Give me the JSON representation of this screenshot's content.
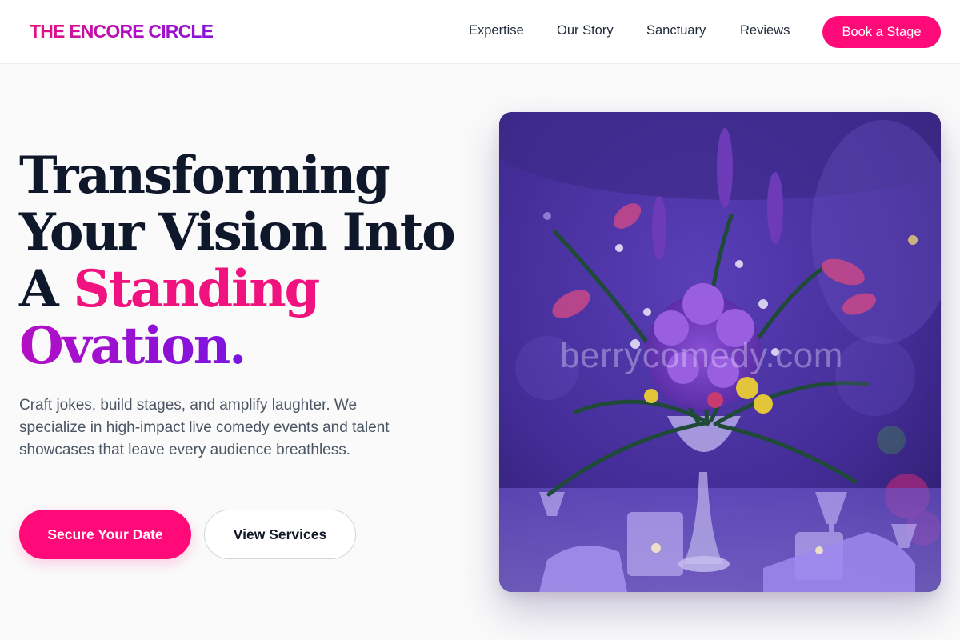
{
  "header": {
    "logo": "THE ENCORE CIRCLE",
    "nav": [
      "Expertise",
      "Our Story",
      "Sanctuary",
      "Reviews"
    ],
    "cta": "Book a Stage"
  },
  "hero": {
    "title_line1": "Transforming",
    "title_line2": "Your Vision Into",
    "title_line3_prefix": "A ",
    "title_line3_highlight": "Standing",
    "title_line4": "Ovation.",
    "description": "Craft jokes, build stages, and amplify laughter. We specialize in high-impact live comedy events and talent showcases that leave every audience breathless.",
    "primary_button": "Secure Your Date",
    "secondary_button": "View Services",
    "image_watermark": "berrycomedy.com"
  },
  "colors": {
    "accent_pink": "#ff0a78",
    "accent_purple": "#7a14e0",
    "heading": "#0f172a",
    "body_text": "#4b5563"
  }
}
